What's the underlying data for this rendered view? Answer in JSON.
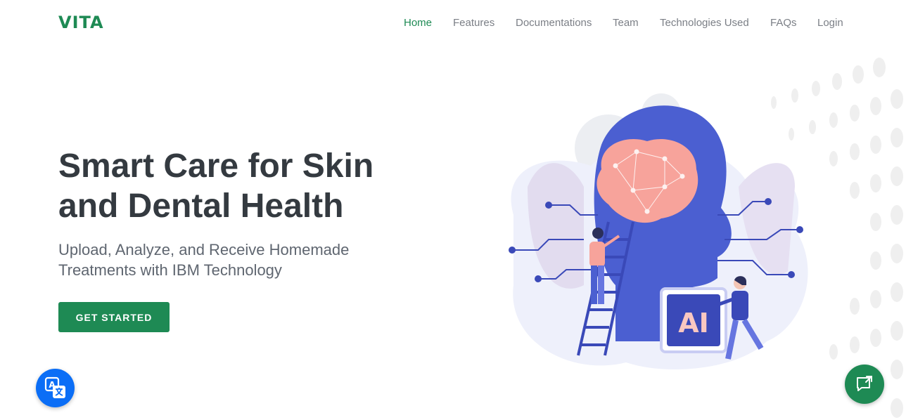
{
  "brand": {
    "logo": "VITA"
  },
  "nav": {
    "items": [
      {
        "label": "Home",
        "active": true
      },
      {
        "label": "Features",
        "active": false
      },
      {
        "label": "Documentations",
        "active": false
      },
      {
        "label": "Team",
        "active": false
      },
      {
        "label": "Technologies Used",
        "active": false
      },
      {
        "label": "FAQs",
        "active": false
      },
      {
        "label": "Login",
        "active": false
      }
    ]
  },
  "hero": {
    "title_line1": "Smart Care for Skin",
    "title_line2": "and Dental Health",
    "subtitle_line1": "Upload, Analyze, and Receive Homemade",
    "subtitle_line2": "Treatments with IBM Technology",
    "cta_label": "GET STARTED",
    "illustration_badge": "AI"
  },
  "floating": {
    "translate_icon": "translate-icon",
    "chat_icon": "chat-icon"
  },
  "colors": {
    "brand_green": "#1e8a54",
    "heading": "#343a40",
    "nav_text": "#7b7f86",
    "translate_blue": "#0b6ef6",
    "illustration_blue": "#4b5fd1",
    "illustration_pink": "#f7a39b"
  }
}
